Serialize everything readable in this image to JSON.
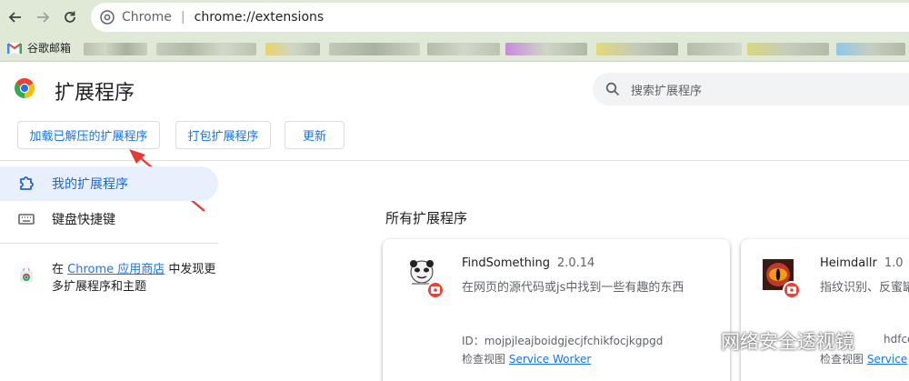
{
  "browser": {
    "omnibox_host": "Chrome",
    "omnibox_sep": "|",
    "omnibox_url": "chrome://extensions",
    "bookmarks": {
      "gmail_label": "谷歌邮箱"
    }
  },
  "page": {
    "title": "扩展程序",
    "search_placeholder": "搜索扩展程序"
  },
  "toolbar": {
    "load_unpacked": "加载已解压的扩展程序",
    "pack": "打包扩展程序",
    "update": "更新"
  },
  "sidebar": {
    "items": [
      {
        "label": "我的扩展程序",
        "icon": "puzzle-icon"
      },
      {
        "label": "键盘快捷键",
        "icon": "keyboard-icon"
      }
    ],
    "store": {
      "prefix": "在 ",
      "link": "Chrome 应用商店",
      "suffix": " 中发现更多扩展程序和主题"
    }
  },
  "main": {
    "section_title": "所有扩展程序",
    "extensions": [
      {
        "name": "FindSomething",
        "version": "2.0.14",
        "description": "在网页的源代码或js中找到一些有趣的东西",
        "id_label": "ID：",
        "id": "mojpjleajboidgjecjfchikfocjkgpgd",
        "inspect_label": "检查视图",
        "inspect_link": "Service Worker"
      },
      {
        "name": "Heimdallr",
        "version": "1.0",
        "description": "指纹识别、反蜜罐",
        "id_fragment": "hdfcd",
        "inspect_label": "检查视图",
        "inspect_link": "Service"
      }
    ]
  },
  "watermark": {
    "text": "网络安全透视镜"
  },
  "colors": {
    "accent": "#1a73e8",
    "toolbar_bg": "#dfe9d6",
    "active_bg": "#e8f0fe",
    "arrow": "#e53935"
  }
}
